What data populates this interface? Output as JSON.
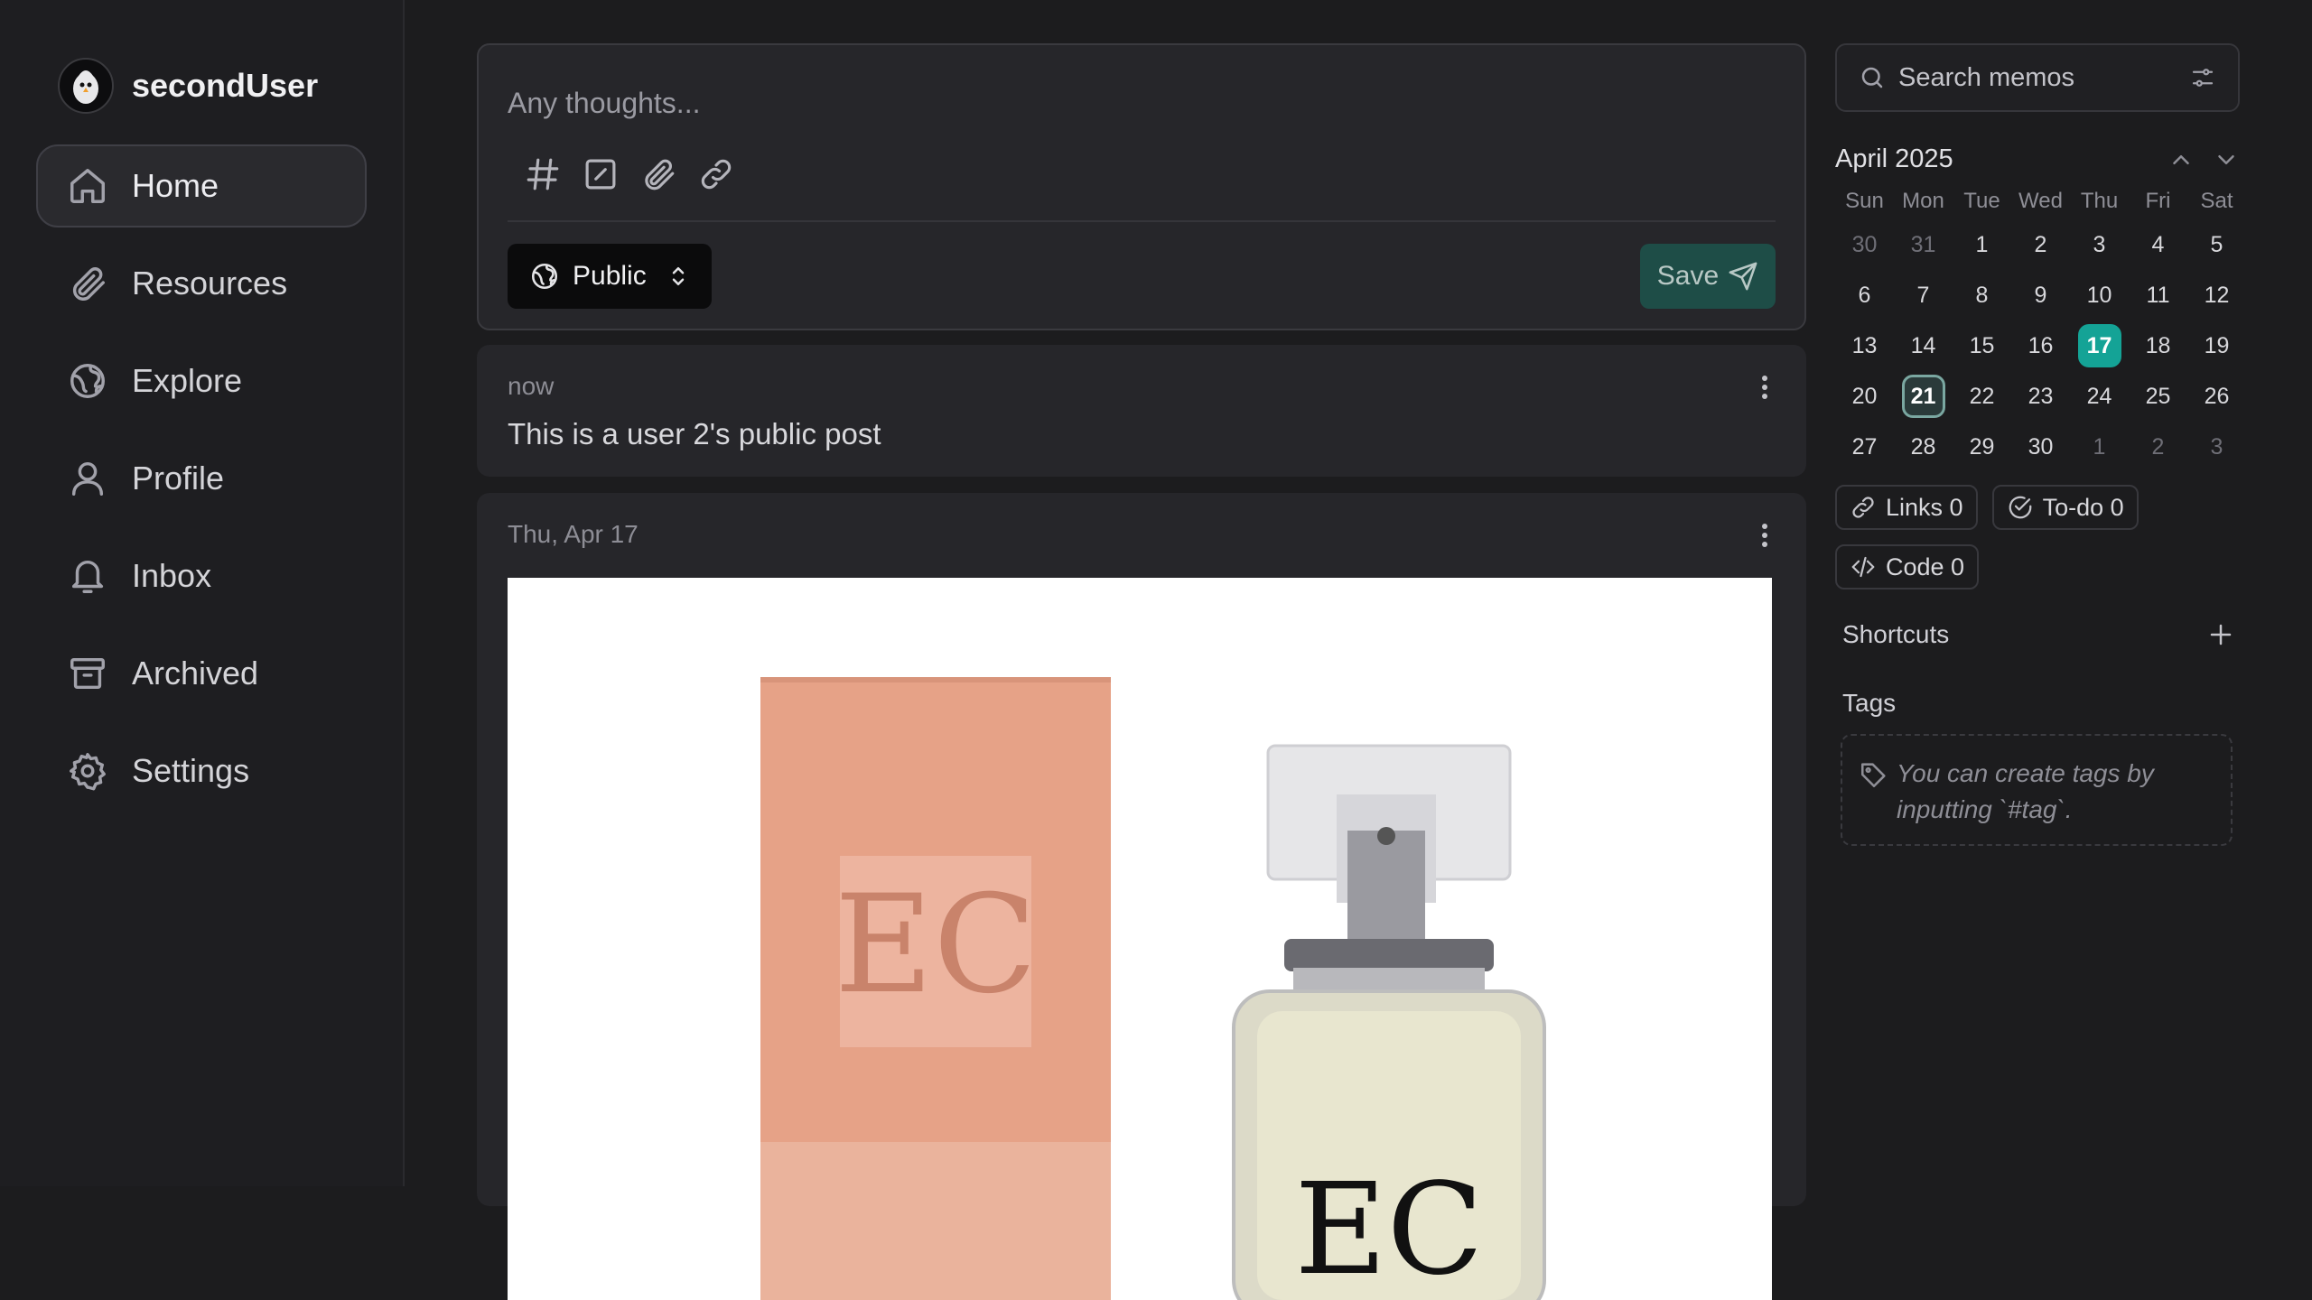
{
  "sidebar": {
    "username": "secondUser",
    "nav": [
      {
        "label": "Home",
        "icon": "home-icon",
        "active": true
      },
      {
        "label": "Resources",
        "icon": "paperclip-icon"
      },
      {
        "label": "Explore",
        "icon": "globe-icon"
      },
      {
        "label": "Profile",
        "icon": "user-icon"
      },
      {
        "label": "Inbox",
        "icon": "bell-icon"
      },
      {
        "label": "Archived",
        "icon": "archive-icon"
      },
      {
        "label": "Settings",
        "icon": "gear-icon"
      }
    ]
  },
  "composer": {
    "placeholder": "Any thoughts...",
    "visibility": "Public",
    "save_label": "Save"
  },
  "memos": [
    {
      "time": "now",
      "content": "This is a user 2's public post"
    },
    {
      "time": "Thu, Apr 17",
      "content": ""
    }
  ],
  "search": {
    "placeholder": "Search memos"
  },
  "calendar": {
    "title": "April 2025",
    "weekdays": [
      "Sun",
      "Mon",
      "Tue",
      "Wed",
      "Thu",
      "Fri",
      "Sat"
    ],
    "days": [
      [
        "30",
        "31",
        "1",
        "2",
        "3",
        "4",
        "5"
      ],
      [
        "6",
        "7",
        "8",
        "9",
        "10",
        "11",
        "12"
      ],
      [
        "13",
        "14",
        "15",
        "16",
        "17",
        "18",
        "19"
      ],
      [
        "20",
        "21",
        "22",
        "23",
        "24",
        "25",
        "26"
      ],
      [
        "27",
        "28",
        "29",
        "30",
        "1",
        "2",
        "3"
      ]
    ],
    "highlighted_day": "17",
    "selected_day": "21"
  },
  "stats": {
    "links": "Links 0",
    "todo": "To-do 0",
    "code": "Code 0"
  },
  "shortcuts": {
    "title": "Shortcuts"
  },
  "tags": {
    "title": "Tags",
    "hint": "You can create tags by inputting `#tag`."
  },
  "colors": {
    "accent": "#14a396",
    "save_button": "#1e4d47",
    "background": "#1c1c1e"
  }
}
